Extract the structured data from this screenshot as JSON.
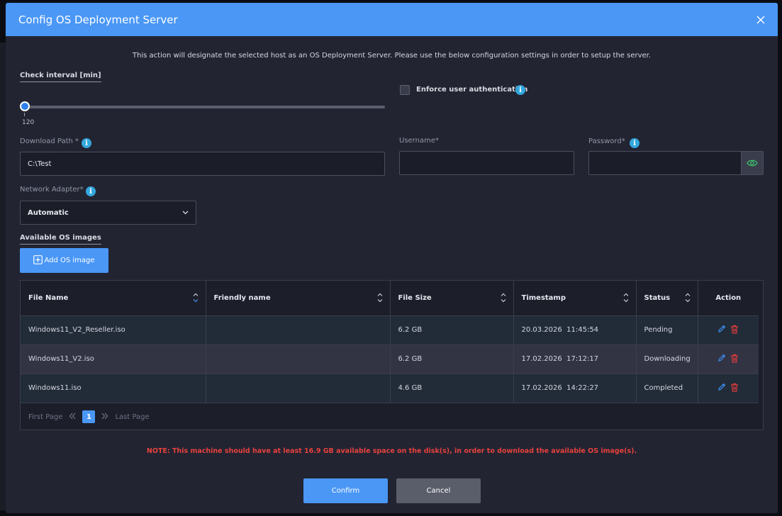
{
  "dialog": {
    "title": "Config OS Deployment Server",
    "intro": "This action will designate the selected host as an OS Deployment Server. Please use the below configuration settings in order to setup the server."
  },
  "interval": {
    "label": "Check interval [min]",
    "value": "120"
  },
  "auth": {
    "label": "Enforce user authentication",
    "checked": false
  },
  "fields": {
    "download_path_label": "Download Path *",
    "download_path_value": "C:\\Test",
    "username_label": "Username*",
    "username_value": "",
    "password_label": "Password*",
    "password_value": "",
    "adapter_label": "Network Adapter*",
    "adapter_value": "Automatic"
  },
  "images": {
    "section_label": "Available OS images",
    "add_label": "Add OS image",
    "columns": [
      "File Name",
      "Friendly name",
      "File Size",
      "Timestamp",
      "Status",
      "Action"
    ],
    "rows": [
      {
        "file": "Windows11_V2_Reseller.iso",
        "friendly": "",
        "size": "6.2 GB",
        "date": "20.03.2026",
        "time": "11:45:54",
        "status": "Pending"
      },
      {
        "file": "Windows11_V2.iso",
        "friendly": "",
        "size": "6.2 GB",
        "date": "17.02.2026",
        "time": "17:12:17",
        "status": "Downloading"
      },
      {
        "file": "Windows11.iso",
        "friendly": "",
        "size": "4.6 GB",
        "date": "17.02.2026",
        "time": "14:22:27",
        "status": "Completed"
      }
    ],
    "pager": {
      "first": "First Page",
      "last": "Last Page",
      "current": "1"
    }
  },
  "note": "NOTE: This machine should have at least 16.9 GB available space on the disk(s), in order to download the available OS image(s).",
  "buttons": {
    "confirm": "Confirm",
    "cancel": "Cancel"
  },
  "colors": {
    "accent": "#4a97f6",
    "info": "#34a7de",
    "warning": "#e8413d",
    "eye": "#3cc06a",
    "edit": "#3d8ef0",
    "delete": "#e23b3b"
  }
}
